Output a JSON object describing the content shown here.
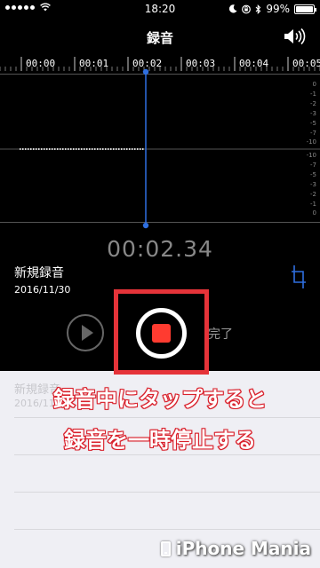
{
  "status_bar": {
    "time": "18:20",
    "battery_text": "99%",
    "battery_level": 0.99
  },
  "nav": {
    "title": "録音",
    "speaker_icon": "speaker-volume-icon"
  },
  "timeline": {
    "ticks": [
      "00:00",
      "00:01",
      "00:02",
      "00:03",
      "00:04",
      "00:05"
    ],
    "playhead_time": "00:02"
  },
  "waveform": {
    "scale_top": [
      "0",
      "-1",
      "-2",
      "-3",
      "-5",
      "-7",
      "-10"
    ],
    "scale_bottom": [
      "-10",
      "-7",
      "-5",
      "-3",
      "-2",
      "-1",
      "0"
    ]
  },
  "recording": {
    "elapsed": "00:02.34",
    "name": "新規録音",
    "date": "2016/11/30",
    "done_label": "完了"
  },
  "list": {
    "item_title": "新規録音",
    "item_date": "2016/11/30"
  },
  "annotation": {
    "line1": "録音中にタップすると",
    "line2": "録音を一時停止する",
    "accent_color": "#e53339"
  },
  "watermark": {
    "text": "iPhone Mania"
  }
}
